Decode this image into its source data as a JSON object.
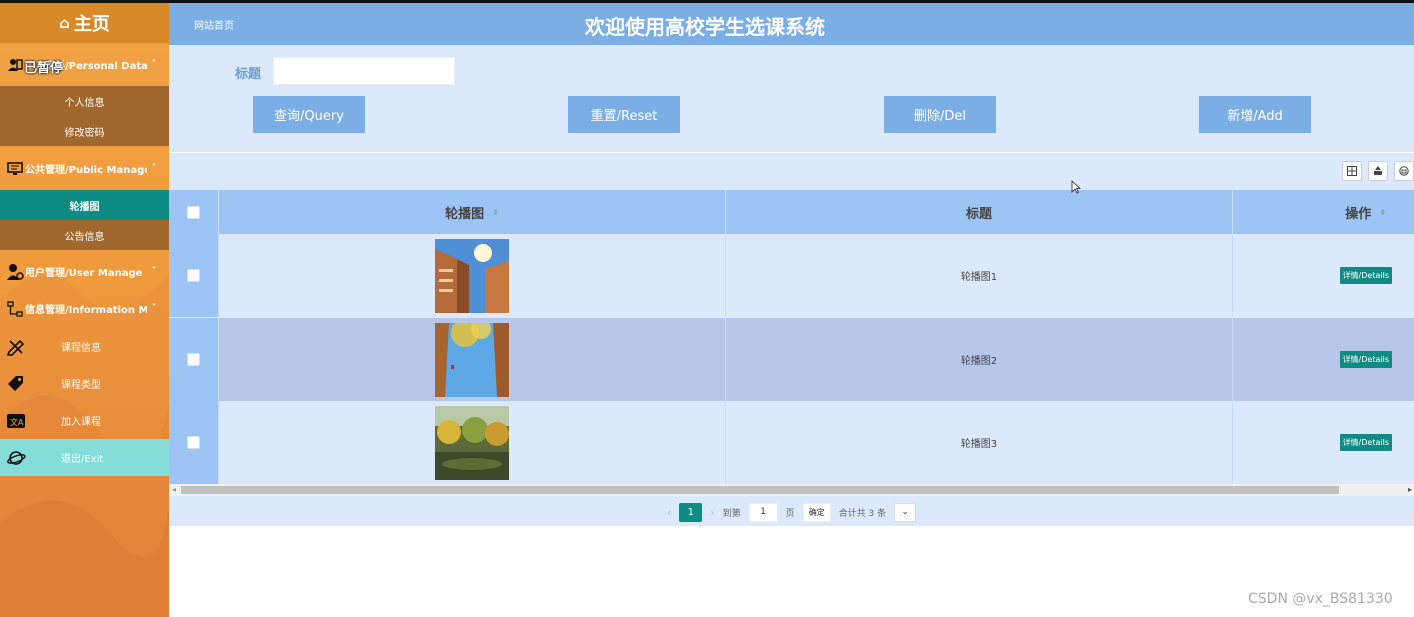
{
  "sidebar": {
    "home_label": "主页",
    "groups": [
      {
        "label": "个人资料/Personal Data",
        "chevron": "˄",
        "icon": "user-card-icon"
      },
      {
        "label": "公共管理/Public Manage",
        "chevron": "˄",
        "icon": "monitor-icon"
      },
      {
        "label": "用户管理/User Manage",
        "chevron": "˅",
        "icon": "user-gear-icon"
      },
      {
        "label": "信息管理/Information Manage",
        "chevron": "˅",
        "icon": "org-chart-icon"
      }
    ],
    "subitems": [
      "个人信息",
      "修改密码",
      "轮播图",
      "公告信息"
    ],
    "items": [
      {
        "label": "课程信息",
        "icon": "pencil-ruler-icon"
      },
      {
        "label": "课程类型",
        "icon": "tags-icon"
      },
      {
        "label": "加入课程",
        "icon": "translate-icon"
      },
      {
        "label": "退出/Exit",
        "icon": "planet-icon"
      }
    ],
    "overlay": "已暂停"
  },
  "header": {
    "breadcrumb": "网站首页",
    "title": "欢迎使用高校学生选课系统"
  },
  "search": {
    "label": "标题",
    "value": "",
    "buttons": {
      "query": "查询/Query",
      "reset": "重置/Reset",
      "delete": "删除/Del",
      "add": "新增/Add"
    }
  },
  "toolbar": [
    "column-icon",
    "export-icon",
    "print-icon"
  ],
  "table": {
    "headers": {
      "image": "轮播图",
      "title": "标题",
      "ops": "操作"
    },
    "rows": [
      {
        "title": "轮播图1",
        "action": "详情/Details"
      },
      {
        "title": "轮播图2",
        "action": "详情/Details"
      },
      {
        "title": "轮播图3",
        "action": "详情/Details"
      }
    ]
  },
  "pager": {
    "current": "1",
    "goto_prefix": "到第",
    "goto_value": "1",
    "goto_suffix": "页",
    "confirm": "确定",
    "total": "合计共 3 条"
  },
  "watermark": "CSDN @vx_BS81330"
}
